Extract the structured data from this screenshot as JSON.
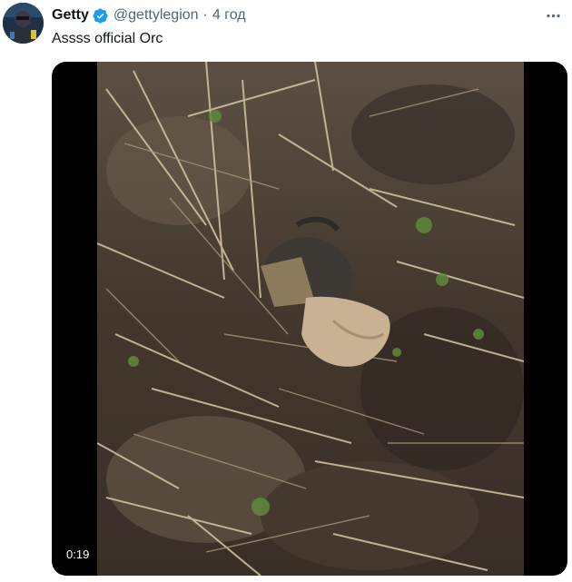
{
  "tweet": {
    "author": {
      "display_name": "Getty",
      "handle": "@gettylegion",
      "verified": true,
      "avatar_icon": "avatar-image"
    },
    "separator": "·",
    "timestamp": "4 год",
    "text": "Assss official Orc",
    "more_icon": "more-horizontal-icon",
    "media": {
      "type": "video",
      "duration": "0:19"
    }
  },
  "colors": {
    "text_primary": "#0f1419",
    "text_secondary": "#536471",
    "verified_blue": "#1d9bf0",
    "media_background": "#000000"
  }
}
